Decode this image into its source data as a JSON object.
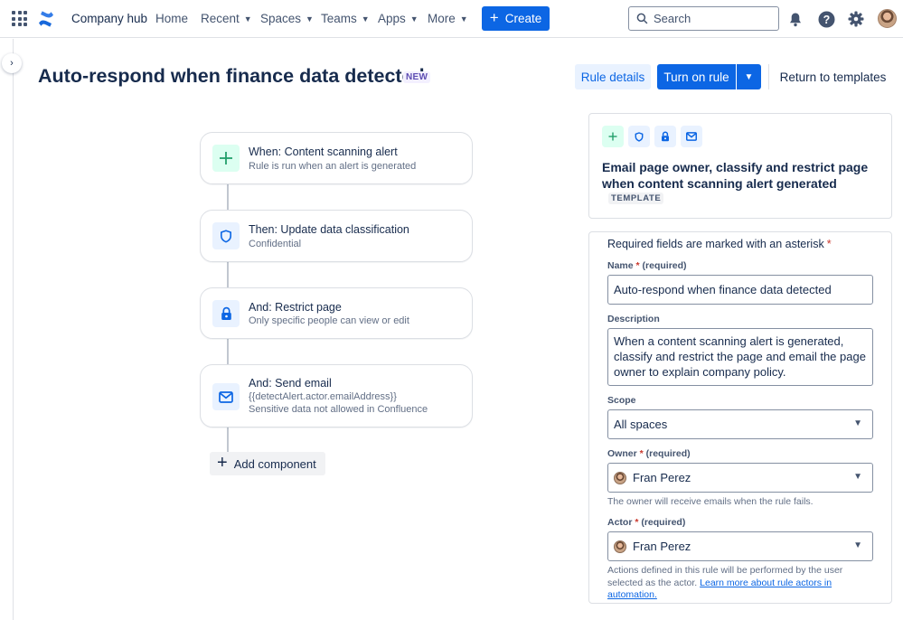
{
  "topnav": {
    "company_hub": "Company hub",
    "home": "Home",
    "recent": "Recent",
    "spaces": "Spaces",
    "teams": "Teams",
    "apps": "Apps",
    "more": "More",
    "create": "Create",
    "search_placeholder": "Search"
  },
  "header": {
    "title": "Auto-respond when finance data detected",
    "new_badge": "NEW",
    "rule_details": "Rule details",
    "turn_on_rule": "Turn on rule",
    "return_to_templates": "Return to templates"
  },
  "flow": {
    "components": [
      {
        "title": "When: Content scanning alert",
        "subtitle": "Rule is run when an alert is generated",
        "icon": "plus-icon",
        "color": "#22a06b"
      },
      {
        "title": "Then: Update data classification",
        "subtitle": "Confidential",
        "icon": "shield-icon",
        "color": "#0c66e4"
      },
      {
        "title": "And: Restrict page",
        "subtitle": "Only specific people can view or edit",
        "icon": "lock-icon",
        "color": "#0c66e4"
      },
      {
        "title": "And: Send email",
        "subtitle": "{{detectAlert.actor.emailAddress}}",
        "subtitle2": "Sensitive data not allowed in Confluence",
        "icon": "envelope-icon",
        "color": "#0c66e4"
      }
    ],
    "add_component": "Add component"
  },
  "template": {
    "icons": [
      "plus-icon",
      "shield-icon",
      "lock-icon",
      "envelope-icon"
    ],
    "title": "Email page owner, classify and restrict page when content scanning alert generated",
    "badge": "TEMPLATE"
  },
  "form": {
    "required_note": "Required fields are marked with an asterisk",
    "name": {
      "label": "Name",
      "required": "(required)",
      "value": "Auto-respond when finance data detected"
    },
    "description": {
      "label": "Description",
      "value": "When a content scanning alert is generated, classify and restrict the page and email the page owner to explain company policy."
    },
    "scope": {
      "label": "Scope",
      "value": "All spaces"
    },
    "owner": {
      "label": "Owner",
      "required": "(required)",
      "value": "Fran Perez",
      "helper": "The owner will receive emails when the rule fails."
    },
    "actor": {
      "label": "Actor",
      "required": "(required)",
      "value": "Fran Perez",
      "helper_prefix": "Actions defined in this rule will be performed by the user selected as the actor.",
      "helper_link": "Learn more about rule actors in automation."
    }
  },
  "colors": {
    "brand_blue": "#0c66e4",
    "green_accent": "#22a06b",
    "required_red": "#c9372c"
  }
}
